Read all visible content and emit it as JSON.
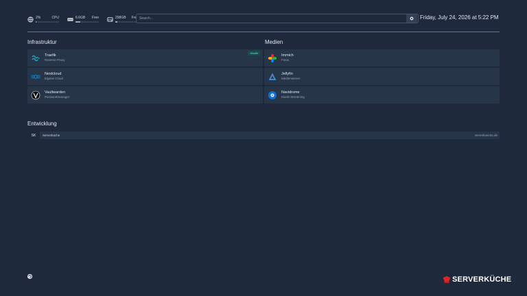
{
  "widgets": [
    {
      "value": "2%",
      "label": "CPU",
      "fill": 0.02,
      "icon": "cpu-icon"
    },
    {
      "value": "6.6GB",
      "label": "Free",
      "fill": 0.2,
      "icon": "memory-icon"
    },
    {
      "value": "298GB",
      "label": "Free",
      "fill": 0.1,
      "icon": "disk-icon"
    }
  ],
  "search": {
    "placeholder": "Search..."
  },
  "datetime": "Friday, July 24, 2026 at 5:22 PM",
  "groups": {
    "infrastruktur": {
      "title": "Infrastruktur",
      "services": [
        {
          "name": "Traefik",
          "desc": "Reverse Proxy",
          "badge": "Health",
          "icon": "traefik-icon"
        },
        {
          "name": "Nextcloud",
          "desc": "Eigene Cloud",
          "icon": "nextcloud-icon"
        },
        {
          "name": "Vaultwarden",
          "desc": "Passwortmanager",
          "icon": "vaultwarden-icon"
        }
      ]
    },
    "medien": {
      "title": "Medien",
      "services": [
        {
          "name": "Immich",
          "desc": "Fotos",
          "icon": "immich-icon"
        },
        {
          "name": "Jellyfin",
          "desc": "Medienserver",
          "icon": "jellyfin-icon"
        },
        {
          "name": "Navidrome",
          "desc": "Musik-Streaming",
          "icon": "navidrome-icon"
        }
      ]
    },
    "entwicklung": {
      "title": "Entwicklung",
      "bookmarks": [
        {
          "abbr": "SK",
          "name": "Serverküche",
          "href": "serverkueche.de"
        }
      ]
    }
  },
  "logo": {
    "text": "SERVERKÜCHE",
    "color": "#dc2626"
  },
  "colors": {
    "background": "#1e293b",
    "card": "#273548",
    "accent": "#dc2626"
  }
}
